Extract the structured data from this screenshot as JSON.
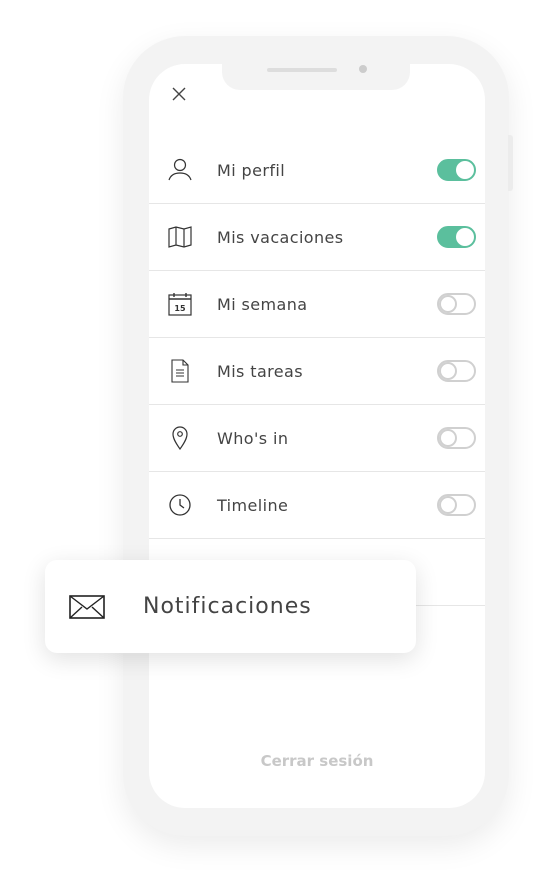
{
  "menu": {
    "items": [
      {
        "label": "Mi perfil",
        "icon": "user-icon",
        "enabled": true
      },
      {
        "label": "Mis vacaciones",
        "icon": "map-icon",
        "enabled": true
      },
      {
        "label": "Mi semana",
        "icon": "calendar-icon",
        "calendar_day": "15",
        "enabled": false
      },
      {
        "label": "Mis tareas",
        "icon": "document-icon",
        "enabled": false
      },
      {
        "label": "Who's in",
        "icon": "location-pin-icon",
        "enabled": false
      },
      {
        "label": "Timeline",
        "icon": "clock-icon",
        "enabled": false
      }
    ]
  },
  "floating_card": {
    "label": "Notificaciones",
    "icon": "envelope-icon"
  },
  "logout_label": "Cerrar sesión",
  "colors": {
    "toggle_on": "#5bbf9d",
    "toggle_off": "#d0d0d0"
  }
}
